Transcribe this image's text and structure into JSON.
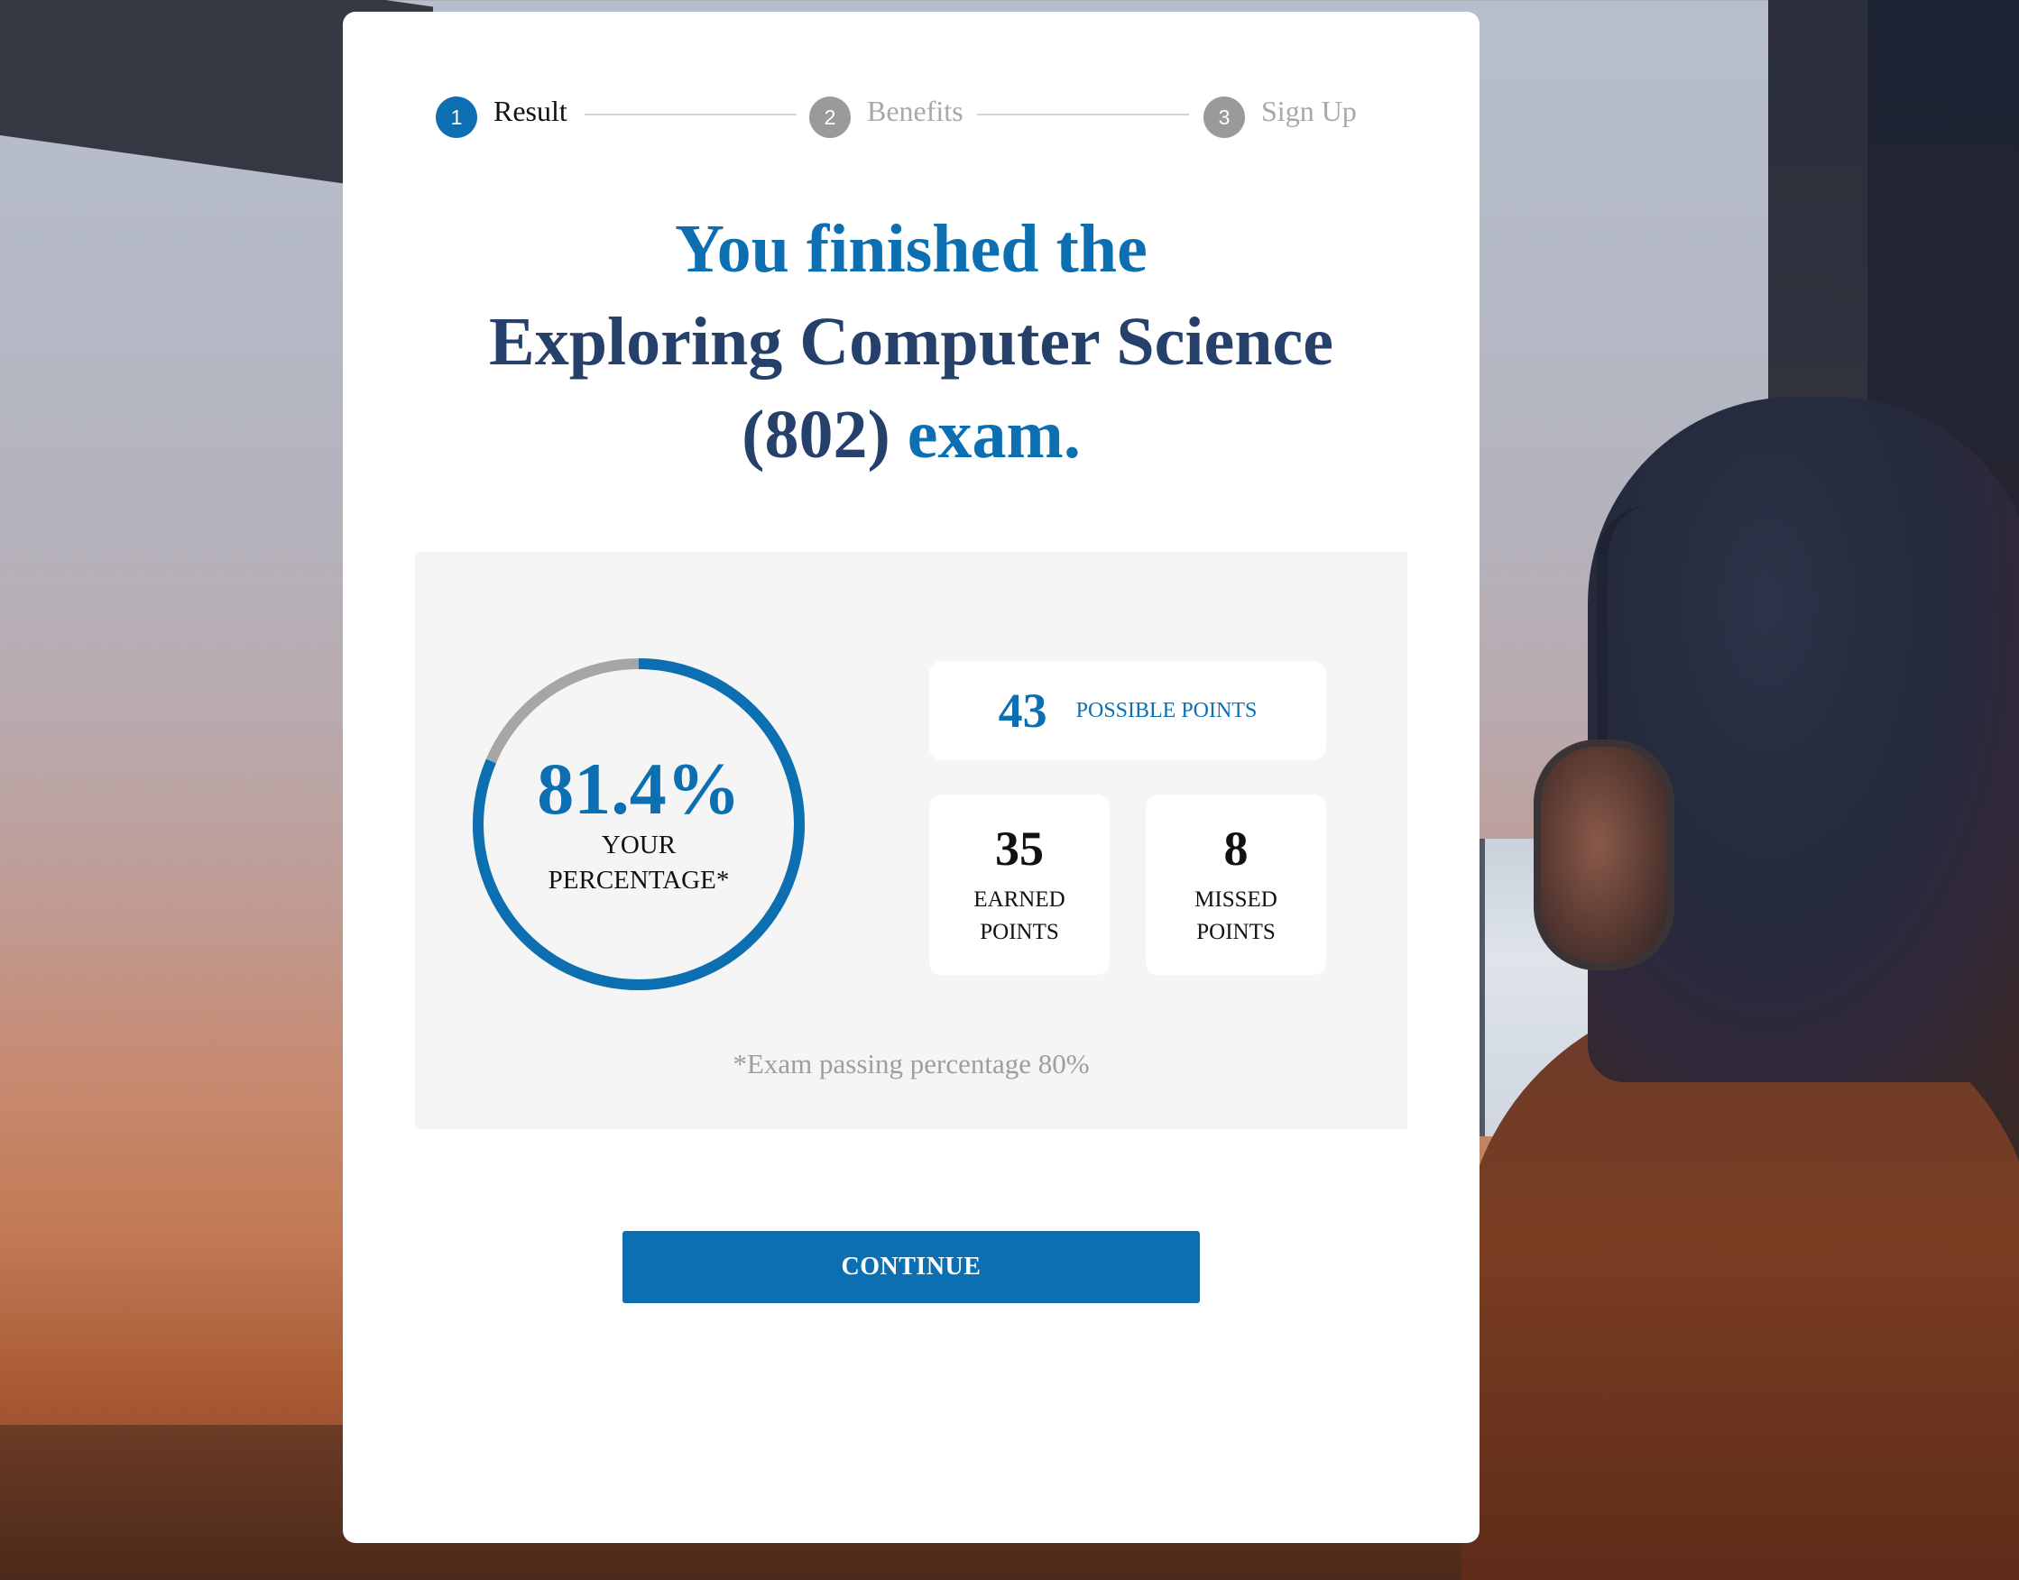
{
  "stepper": {
    "steps": [
      {
        "number": "1",
        "label": "Result",
        "state": "active"
      },
      {
        "number": "2",
        "label": "Benefits",
        "state": "inactive"
      },
      {
        "number": "3",
        "label": "Sign Up",
        "state": "inactive"
      }
    ]
  },
  "headline": {
    "line1": "You finished the",
    "exam_name": "Exploring Computer Science",
    "exam_code": "(802)",
    "suffix": "exam."
  },
  "results": {
    "percentage": "81.4%",
    "percentage_fraction": 0.814,
    "percentage_label": "YOUR PERCENTAGE*",
    "possible_points": "43",
    "possible_points_label": "POSSIBLE POINTS",
    "earned_points": "35",
    "earned_points_label": "EARNED POINTS",
    "missed_points": "8",
    "missed_points_label": "MISSED POINTS",
    "passing_note": "*Exam passing percentage 80%"
  },
  "actions": {
    "continue_label": "CONTINUE"
  },
  "colors": {
    "accent": "#0b6fb2",
    "navy": "#24406b",
    "ring_track": "#a6a6a8",
    "panel_bg": "#f5f5f5"
  }
}
